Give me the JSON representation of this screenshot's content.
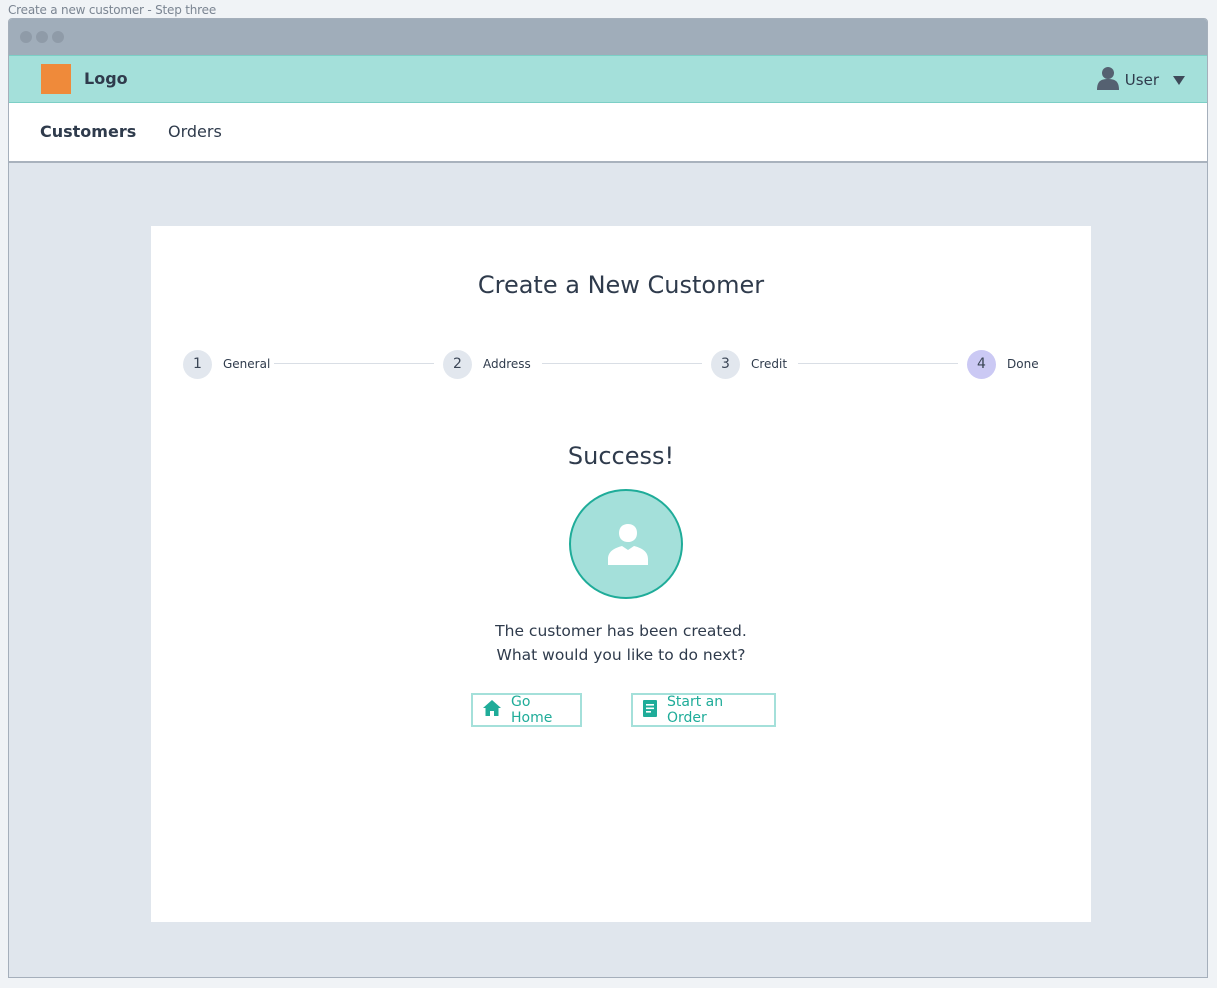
{
  "caption": "Create a new customer - Step three",
  "header": {
    "logo_text": "Logo",
    "user_label": "User"
  },
  "nav": {
    "items": [
      {
        "label": "Customers",
        "active": true
      },
      {
        "label": "Orders",
        "active": false
      }
    ]
  },
  "page": {
    "title": "Create a New Customer",
    "steps": [
      {
        "number": "1",
        "label": "General"
      },
      {
        "number": "2",
        "label": "Address"
      },
      {
        "number": "3",
        "label": "Credit"
      },
      {
        "number": "4",
        "label": "Done",
        "current": true
      }
    ],
    "success_title": "Success!",
    "message_line1": "The customer has been created.",
    "message_line2": "What would you like to do next?",
    "buttons": {
      "go_home": "Go Home",
      "start_order": "Start an Order"
    }
  },
  "colors": {
    "accent": "#1fac99",
    "header_bg": "#a4e0da",
    "logo": "#ef8a3a",
    "current_step": "#cbc9f4"
  },
  "icons": [
    "user-icon",
    "caret-down-icon",
    "user-avatar-icon",
    "home-icon",
    "document-icon"
  ]
}
